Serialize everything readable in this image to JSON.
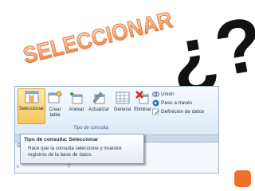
{
  "headline": {
    "title": "SELECCIONAR",
    "question_mark": "¿?"
  },
  "ribbon": {
    "buttons": [
      {
        "label": "Seleccionar",
        "icon": "select-query-icon",
        "active": true
      },
      {
        "label": "Crear\ntabla",
        "icon": "make-table-icon"
      },
      {
        "label": "Anexar",
        "icon": "append-icon"
      },
      {
        "label": "Actualizar",
        "icon": "update-icon"
      },
      {
        "label": "General",
        "icon": "crosstab-icon"
      },
      {
        "label": "Eliminar",
        "icon": "delete-icon"
      }
    ],
    "group_label": "Tipo de consulta",
    "small_buttons": [
      {
        "label": "Unión",
        "icon": "union-icon"
      },
      {
        "label": "Paso a través",
        "icon": "pass-through-icon"
      },
      {
        "label": "Definición de datos",
        "icon": "data-definition-icon"
      }
    ]
  },
  "sheet_fragments": {
    "left_top": "S",
    "left_bottom": "ir",
    "under_tooltip": "T"
  },
  "tooltip": {
    "title": "Tipo de consulta: Seleccionar",
    "body": "Hace que la consulta seleccione y muestre\nregistros de la base de datos."
  },
  "colors": {
    "title_gradient_top": "#ffe0cc",
    "title_gradient_bottom": "#f07a30",
    "title_outline": "#ffffff",
    "question_mark": "#111111",
    "corner_square": "#f26f2a",
    "ribbon_background": "#e6eef8",
    "selected_button": "#f7c65a"
  }
}
